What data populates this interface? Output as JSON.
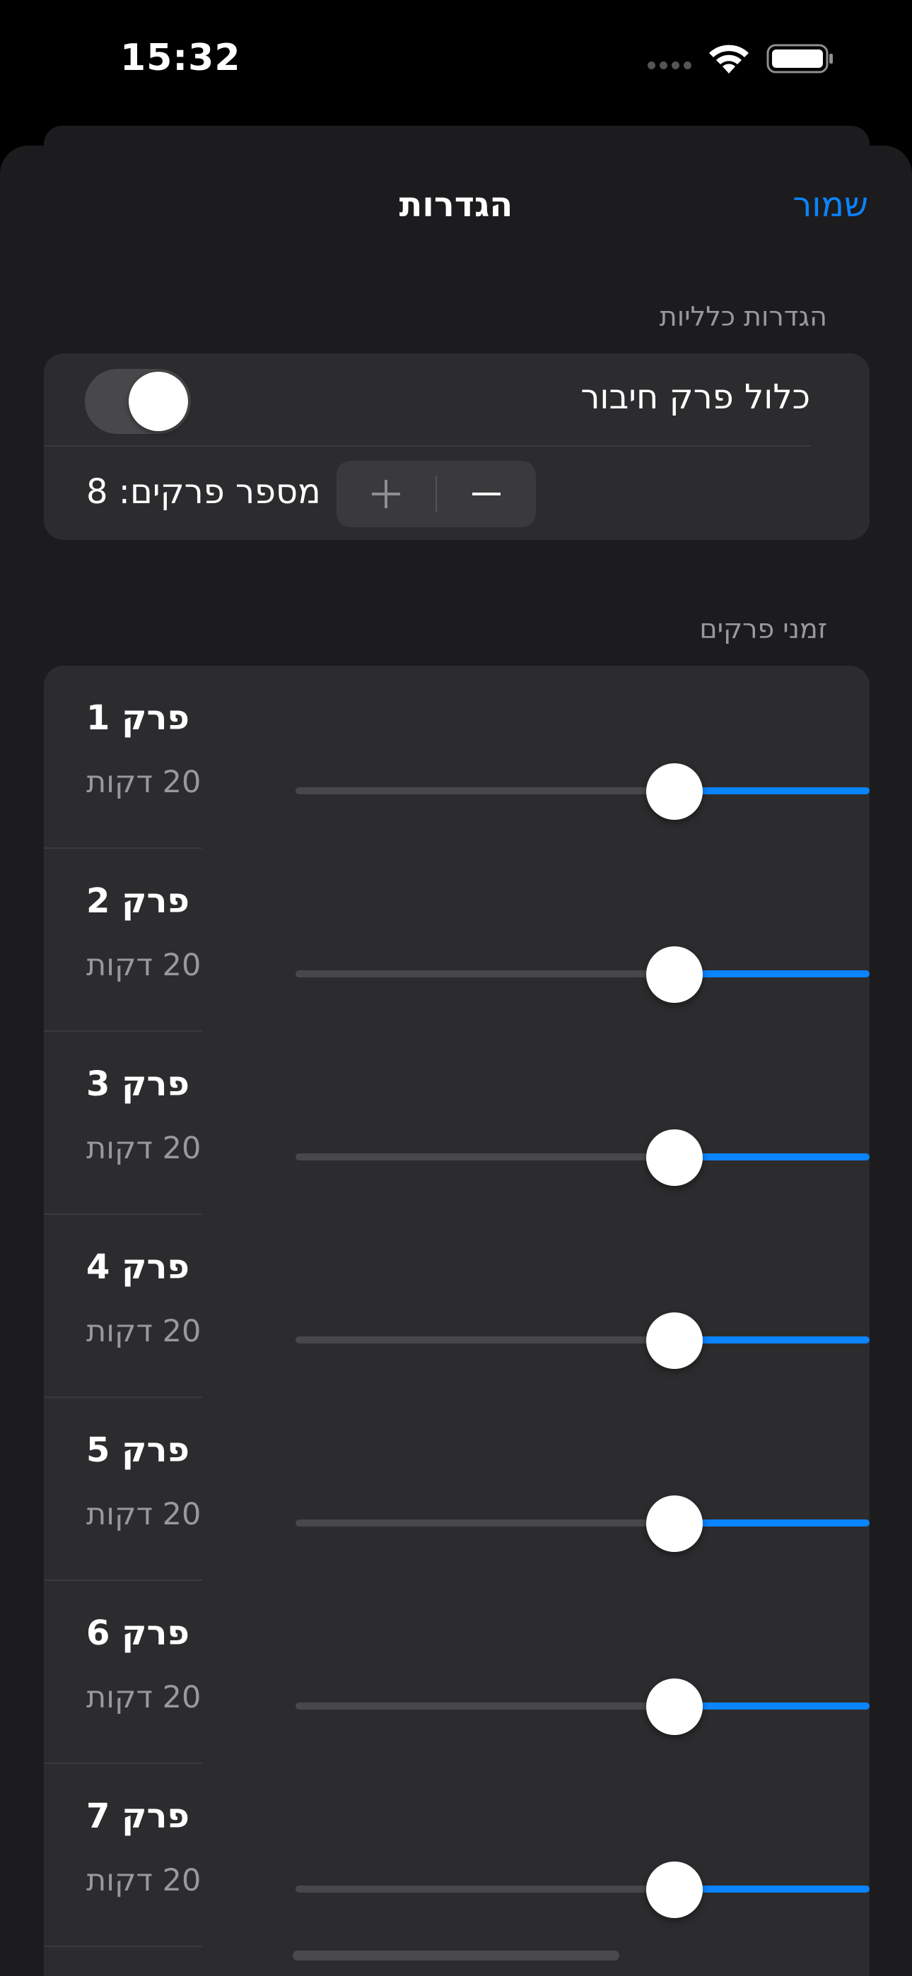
{
  "status_bar": {
    "time": "15:32"
  },
  "nav": {
    "title": "הגדרות",
    "save_label": "שמור"
  },
  "general": {
    "header": "הגדרות כלליות",
    "include_summary_label": "כלול פרק חיבור",
    "include_summary_on": false,
    "chapter_count_label": "מספר פרקים: 8",
    "increment_symbol": "+",
    "decrement_symbol": "−"
  },
  "times": {
    "header": "זמני פרקים",
    "chapters": [
      {
        "title": "פרק 1",
        "duration": "20 דקות",
        "value_fraction": 0.66
      },
      {
        "title": "פרק 2",
        "duration": "20 דקות",
        "value_fraction": 0.66
      },
      {
        "title": "פרק 3",
        "duration": "20 דקות",
        "value_fraction": 0.66
      },
      {
        "title": "פרק 4",
        "duration": "20 דקות",
        "value_fraction": 0.66
      },
      {
        "title": "פרק 5",
        "duration": "20 דקות",
        "value_fraction": 0.66
      },
      {
        "title": "פרק 6",
        "duration": "20 דקות",
        "value_fraction": 0.66
      },
      {
        "title": "פרק 7",
        "duration": "20 דקות",
        "value_fraction": 0.66
      }
    ]
  },
  "colors": {
    "accent": "#0a84ff",
    "background": "#1c1c1e",
    "card": "#2c2c2e"
  },
  "icons": [
    "cellular-signal-icon",
    "wifi-icon",
    "battery-icon",
    "plus-icon",
    "minus-icon"
  ]
}
